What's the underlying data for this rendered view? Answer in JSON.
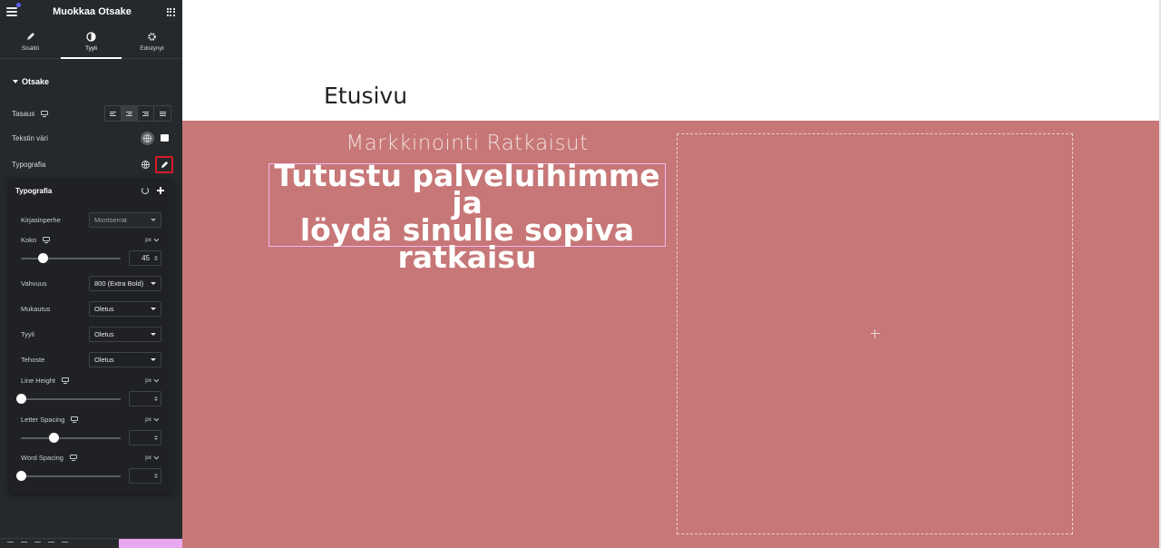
{
  "panel": {
    "title": "Muokkaa Otsake",
    "tabs": [
      {
        "label": "Sisältö",
        "icon": "pencil-icon",
        "active": false
      },
      {
        "label": "Tyyli",
        "icon": "half-circle-icon",
        "active": true
      },
      {
        "label": "Edistynyt",
        "icon": "gear-icon",
        "active": false
      }
    ],
    "section_title": "Otsake",
    "controls": {
      "alignment_label": "Tasaus",
      "text_color_label": "Tekstin väri",
      "typography_label": "Typografia",
      "text_color_swatch": "#ffffff"
    }
  },
  "typography_popover": {
    "title": "Typografia",
    "font_family": {
      "label": "Kirjasinperhe",
      "value": "Montserrat"
    },
    "size": {
      "label": "Koko",
      "unit": "px",
      "value": "45",
      "slider_fraction": 0.22
    },
    "weight": {
      "label": "Vahvuus",
      "value": "800 (Extra Bold)"
    },
    "transform": {
      "label": "Mukautus",
      "value": "Oletus"
    },
    "style": {
      "label": "Tyyli",
      "value": "Oletus"
    },
    "decoration": {
      "label": "Tehoste",
      "value": "Oletus"
    },
    "line_height": {
      "label": "Line Height",
      "unit": "px",
      "value": "",
      "slider_fraction": 0.0
    },
    "letter_spacing": {
      "label": "Letter Spacing",
      "unit": "px",
      "value": "",
      "slider_fraction": 0.33
    },
    "word_spacing": {
      "label": "Word Spacing",
      "unit": "px",
      "value": "",
      "slider_fraction": 0.0
    }
  },
  "canvas": {
    "page_title": "Etusivu",
    "subheading": "Markkinointi Ratkaisut",
    "heading_lines": [
      "Tutustu palveluihimme ja",
      "löydä sinulle sopiva",
      "ratkaisu"
    ],
    "section_bg": "#c77777"
  }
}
